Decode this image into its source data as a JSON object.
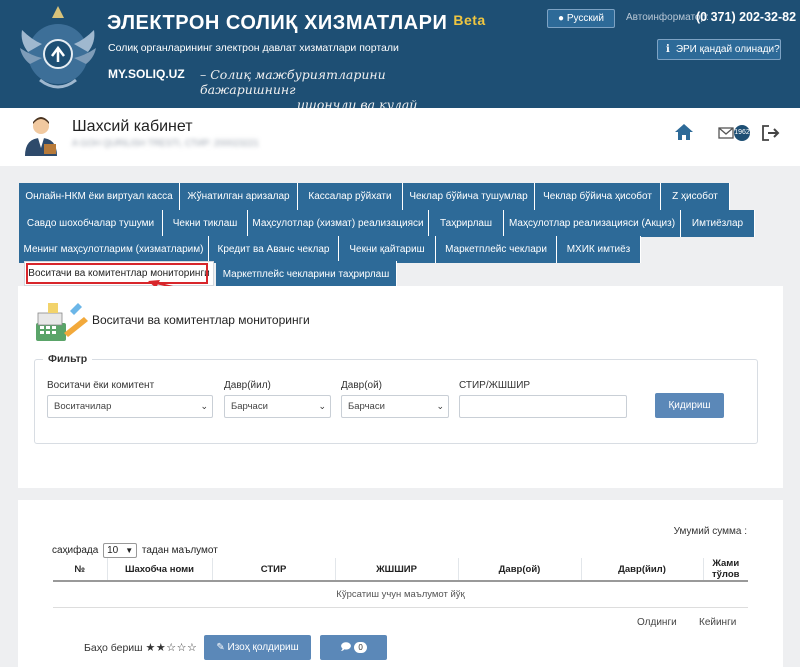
{
  "header": {
    "title": "ЭЛЕКТРОН СОЛИҚ ХИЗМАТЛАРИ",
    "beta": "Beta",
    "subtitle": "Солиқ органларининг электрон давлат хизматлари портали",
    "site_url": "MY.SOLIQ.UZ",
    "slogan_line1": "– Солиқ мажбуриятларини бажаришнинг",
    "slogan_line2": "ишончли ва қулай усули",
    "language_button": "Русский",
    "autoinformator_label": "Автоинформатор:",
    "autoinformator_phone": "(0 371) 202-32-82",
    "eri_button": "ЭРИ қандай олинади?"
  },
  "userbar": {
    "cabinet_title": "Шахсий кабинет",
    "user_details": "A GOH QURILISH TRESTI, СТИР: 200023221",
    "mail_badge": "1962"
  },
  "tabs": {
    "row1": [
      "Онлайн-НКМ ёки виртуал касса",
      "Жўнатилган аризалар",
      "Кассалар рўйхати",
      "Чеклар бўйича тушумлар",
      "Чеклар бўйича ҳисобот",
      "Z ҳисобот"
    ],
    "row2": [
      "Савдо шохобчалар тушуми",
      "Чекни тиклаш",
      "Маҳсулотлар (хизмат) реализацияси",
      "Таҳрирлаш",
      "Маҳсулотлар реализацияси (Акциз)",
      "Имтиёзлар"
    ],
    "row3": [
      "Менинг маҳсулотларим (хизматларим)",
      "Кредит ва Аванс чеклар",
      "Чекни қайтариш",
      "Маркетплейс чеклари",
      "МХИК имтиёз"
    ],
    "row4": [
      "Воситачи ва комитентлар мониторинги",
      "Маркетплейс чекларини таҳрирлаш"
    ]
  },
  "panel": {
    "title": "Воситачи ва комитентлар мониторинги",
    "filter_legend": "Фильтр",
    "fields": {
      "intermediary_label": "Воситачи ёки комитент",
      "intermediary_value": "Воситачилар",
      "year_label": "Давр(йил)",
      "year_value": "Барчаси",
      "month_label": "Давр(ой)",
      "month_value": "Барчаси",
      "stir_label": "СТИР/ЖШШИР",
      "stir_value": ""
    },
    "search_button": "Қидириш"
  },
  "results": {
    "total_sum_label": "Умумий сумма :",
    "per_page_prefix": "саҳифада",
    "per_page_value": "10",
    "per_page_suffix": "тадан маълумот",
    "columns": [
      "№",
      "Шахобча номи",
      "СТИР",
      "ЖШШИР",
      "Давр(ой)",
      "Давр(йил)",
      "Жами тўлов"
    ],
    "empty_message": "Кўрсатиш учун маълумот йўқ",
    "pager_prev": "Олдинги",
    "pager_next": "Кейинги",
    "rate_label": "Баҳо бериш",
    "stars": "★★☆☆☆",
    "rating": 2,
    "comment_button": "Изоҳ қолдириш",
    "chat_count": "0"
  },
  "colors": {
    "header_bg": "#1e4f74",
    "tab_bg": "#2d6a98",
    "button_bg": "#5b88b8",
    "highlight": "#d8262b",
    "beta": "#f0c640"
  }
}
